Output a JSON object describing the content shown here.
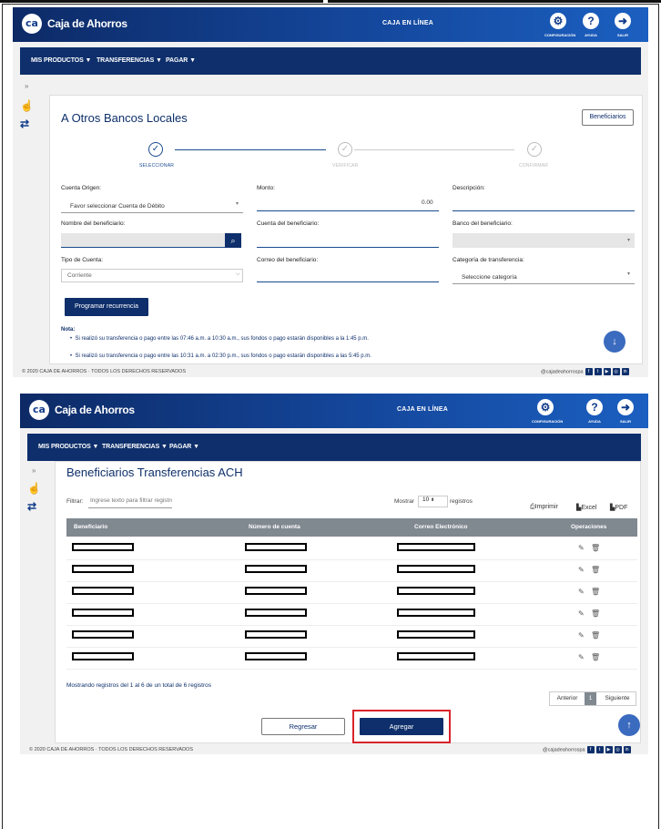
{
  "app": {
    "logo_mark": "ca",
    "logo_text": "Caja de Ahorros",
    "title": "CAJA EN LÍNEA",
    "top_icons": [
      {
        "icon": "gear-icon",
        "label": "CONFIGURACIÓN"
      },
      {
        "icon": "help-icon",
        "label": "AYUDA"
      },
      {
        "icon": "exit-icon",
        "label": "SALIR"
      }
    ],
    "nav": [
      "MIS PRODUCTOS",
      "TRANSFERENCIAS",
      "PAGAR"
    ],
    "footer_copy": "© 2020 CAJA DE AHORROS · TODOS LOS DERECHOS RESERVADOS",
    "footer_handle": "@cajadeahorrospa"
  },
  "screen1": {
    "page_title": "A Otros Bancos Locales",
    "beneficiaries_button": "Beneficiarios",
    "steps": [
      "SELECCIONAR",
      "VERIFICAR",
      "CONFIRMAR"
    ],
    "fields": {
      "origin_label": "Cuenta Origen:",
      "origin_value": "Favor seleccionar Cuenta de Débito",
      "amount_label": "Monto:",
      "amount_value": "0.00",
      "description_label": "Descripción:",
      "beneficiary_name_label": "Nombre del beneficiario:",
      "beneficiary_account_label": "Cuenta del beneficiario:",
      "beneficiary_bank_label": "Banco del beneficiario:",
      "account_type_label": "Tipo de Cuenta:",
      "account_type_value": "Corriente",
      "beneficiary_email_label": "Correo del beneficiario:",
      "category_label": "Categoría de transferencia:",
      "category_value": "Seleccione categoría"
    },
    "schedule_button": "Programar recurrencia",
    "note_title": "Nota:",
    "notes": [
      "Si realizó su transferencia o pago entre las 07:46 a.m. a 10:30 a.m., sus fondos o pago estarán disponibles a la 1:45 p.m.",
      "Si realizó su transferencia o pago entre las 10:31 a.m. a 02:30 p.m., sus fondos o pago estarán disponibles a las 5:45 p.m."
    ]
  },
  "screen2": {
    "page_title": "Beneficiarios Transferencias ACH",
    "filter_label": "Filtrar:",
    "filter_placeholder": "Ingrese texto para filtrar registros",
    "show_label": "Mostrar",
    "show_value": "10",
    "records_label": "registros",
    "exports": [
      "Imprimir",
      "Excel",
      "PDF"
    ],
    "columns": [
      "Beneficiario",
      "Número de cuenta",
      "Correo Electrónico",
      "Operaciones"
    ],
    "row_count": 6,
    "showing_text": "Mostrando registros del 1 al 6 de un total de 6 registros",
    "pager": {
      "prev": "Anterior",
      "current": "1",
      "next": "Siguiente"
    },
    "back_button": "Regresar",
    "add_button": "Agregar",
    "highlight_color": "#d9232a"
  }
}
